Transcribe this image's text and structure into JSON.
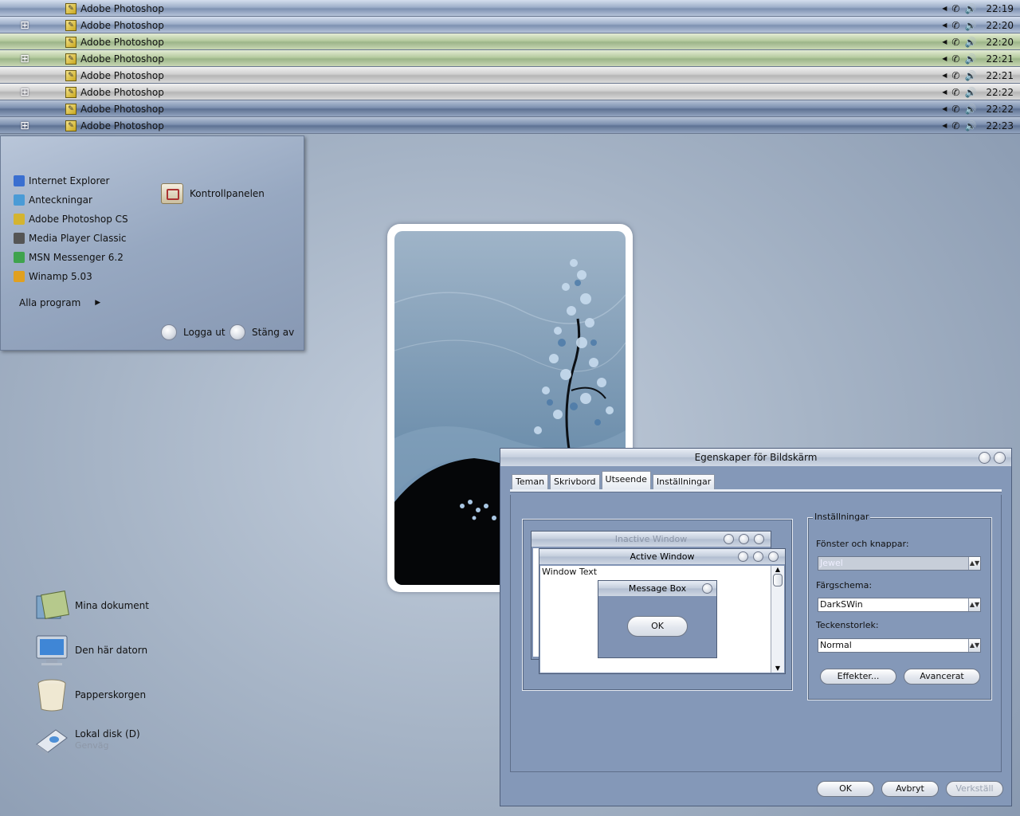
{
  "taskbars": [
    {
      "theme": "blue",
      "start_icon": "apple-icon",
      "start_glyph": "",
      "task_label": "Adobe Photoshop",
      "clock": "22:19"
    },
    {
      "theme": "blue",
      "start_icon": "windows-icon",
      "start_glyph": "⊞",
      "task_label": "Adobe Photoshop",
      "clock": "22:20"
    },
    {
      "theme": "green",
      "start_icon": "apple-icon",
      "start_glyph": "",
      "task_label": "Adobe Photoshop",
      "clock": "22:20"
    },
    {
      "theme": "green",
      "start_icon": "windows-icon",
      "start_glyph": "⊞",
      "task_label": "Adobe Photoshop",
      "clock": "22:21"
    },
    {
      "theme": "silver",
      "start_icon": "apple-icon",
      "start_glyph": "",
      "task_label": "Adobe Photoshop",
      "clock": "22:21"
    },
    {
      "theme": "silver",
      "start_icon": "windows-icon",
      "start_glyph": "⊞",
      "task_label": "Adobe Photoshop",
      "clock": "22:22"
    },
    {
      "theme": "dark",
      "start_icon": "apple-icon",
      "start_glyph": "",
      "task_label": "Adobe Photoshop",
      "clock": "22:22"
    },
    {
      "theme": "dark",
      "start_icon": "windows-icon",
      "start_glyph": "⊞",
      "task_label": "Adobe Photoshop",
      "clock": "22:23"
    }
  ],
  "start_menu": {
    "programs": [
      {
        "label": "Internet Explorer",
        "icon": "internet-explorer-icon",
        "color": "#3a6fd0"
      },
      {
        "label": "Anteckningar",
        "icon": "notepad-icon",
        "color": "#4a9bd6"
      },
      {
        "label": "Adobe Photoshop CS",
        "icon": "photoshop-icon",
        "color": "#d4b430"
      },
      {
        "label": "Media Player Classic",
        "icon": "media-player-icon",
        "color": "#555555"
      },
      {
        "label": "MSN Messenger 6.2",
        "icon": "msn-messenger-icon",
        "color": "#3fa34d"
      },
      {
        "label": "Winamp 5.03",
        "icon": "winamp-icon",
        "color": "#e0a020"
      }
    ],
    "all_programs": "Alla program",
    "control_panel": "Kontrollpanelen",
    "log_off": "Logga ut",
    "shut_down": "Stäng av"
  },
  "desktop_icons": [
    {
      "label": "Mina dokument",
      "sub": "",
      "icon": "my-documents-icon"
    },
    {
      "label": "Den här datorn",
      "sub": "",
      "icon": "my-computer-icon"
    },
    {
      "label": "Papperskorgen",
      "sub": "",
      "icon": "recycle-bin-icon"
    },
    {
      "label": "Lokal disk (D)",
      "sub": "Genväg",
      "icon": "local-disk-icon"
    }
  ],
  "dialog": {
    "title": "Egenskaper för Bildskärm",
    "tabs": [
      "Teman",
      "Skrivbord",
      "Utseende",
      "Inställningar"
    ],
    "active_tab": "Utseende",
    "preview": {
      "inactive_title": "Inactive Window",
      "active_title": "Active Window",
      "window_text": "Window Text",
      "message_title": "Message Box",
      "ok": "OK"
    },
    "group_title": "Inställningar",
    "windows_buttons_label": "Fönster och knappar:",
    "windows_buttons_value": "Jewel",
    "color_scheme_label": "Färgschema:",
    "color_scheme_value": "DarkSWin",
    "font_size_label": "Teckenstorlek:",
    "font_size_value": "Normal",
    "effects": "Effekter...",
    "advanced": "Avancerat",
    "ok": "OK",
    "cancel": "Avbryt",
    "apply": "Verkställ"
  }
}
